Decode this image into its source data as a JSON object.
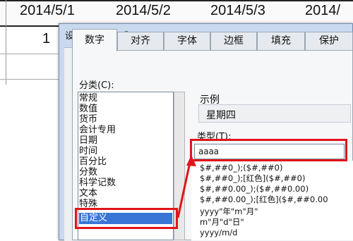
{
  "sheet": {
    "dates": [
      "2014/5/1",
      "2014/5/2",
      "2014/5/3",
      "2014/"
    ],
    "row2_value": "1"
  },
  "dialog": {
    "title": "设置单元格格式",
    "tabs": [
      "数字",
      "对齐",
      "字体",
      "边框",
      "填充",
      "保护"
    ],
    "active_tab": "数字",
    "category_label": "分类(C):",
    "categories": [
      "常规",
      "数值",
      "货币",
      "会计专用",
      "日期",
      "时间",
      "百分比",
      "分数",
      "科学记数",
      "文本",
      "特殊",
      "自定义"
    ],
    "selected_category": "自定义",
    "sample_label": "示例",
    "sample_value": "星期四",
    "type_label": "类型(T):",
    "type_value": "aaaa",
    "format_codes": [
      "$#,##0_);($#,##0)",
      "$#,##0_);[红色]($#,##0)",
      "$#,##0.00_);($#,##0.00)",
      "$#,##0.00_);[红色]($#,##0.00",
      "yyyy\"年\"m\"月\"",
      "m\"月\"d\"日\"",
      "yyyy/m/d"
    ]
  },
  "colors": {
    "highlight": "#e1141b",
    "selection": "#3875d7",
    "dialog_frame": "#c9d9ee"
  },
  "icons": [
    "arrow-annotation"
  ]
}
